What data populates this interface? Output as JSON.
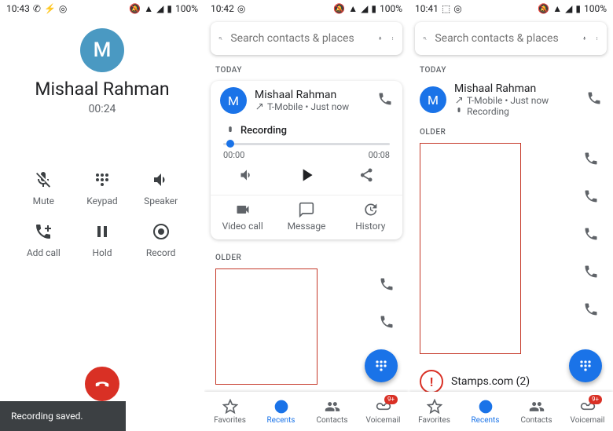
{
  "p1": {
    "time": "10:43",
    "battery": "100%",
    "caller": "Mishaal Rahman",
    "avatarLetter": "M",
    "duration": "00:24",
    "actions": {
      "mute": "Mute",
      "keypad": "Keypad",
      "speaker": "Speaker",
      "addcall": "Add call",
      "hold": "Hold",
      "record": "Record"
    },
    "snackbar": "Recording saved."
  },
  "p2": {
    "time": "10:42",
    "battery": "100%",
    "searchPlaceholder": "Search contacts & places",
    "sectionToday": "TODAY",
    "sectionOlder": "OLDER",
    "entry": {
      "name": "Mishaal Rahman",
      "subtitle": "T-Mobile • Just now",
      "avatarLetter": "M"
    },
    "recording": "Recording",
    "t0": "00:00",
    "t1": "00:08",
    "actions": {
      "video": "Video call",
      "message": "Message",
      "history": "History"
    },
    "nav": {
      "fav": "Favorites",
      "recents": "Recents",
      "contacts": "Contacts",
      "vm": "Voicemail"
    }
  },
  "p3": {
    "time": "10:41",
    "battery": "100%",
    "searchPlaceholder": "Search contacts & places",
    "sectionToday": "TODAY",
    "sectionOlder": "OLDER",
    "entry": {
      "name": "Mishaal Rahman",
      "subtitle": "T-Mobile • Just now",
      "recording": "Recording",
      "avatarLetter": "M"
    },
    "stamps": "Stamps.com  (2)",
    "nav": {
      "fav": "Favorites",
      "recents": "Recents",
      "contacts": "Contacts",
      "vm": "Voicemail"
    }
  }
}
